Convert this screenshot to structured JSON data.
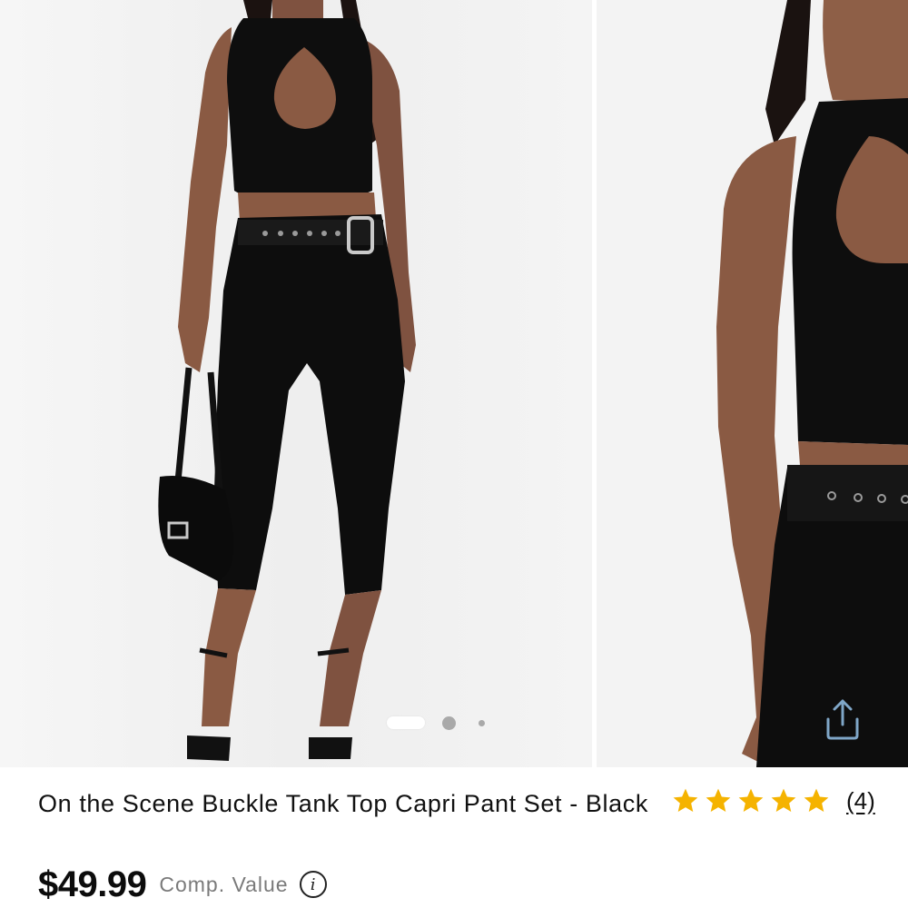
{
  "gallery": {
    "images": [
      {
        "alt": "On the Scene Buckle Tank Top Capri Pant Set - Black, full length front view"
      },
      {
        "alt": "On the Scene Buckle Tank Top Capri Pant Set - Black, close-up"
      }
    ],
    "active_index": 0,
    "total": 3
  },
  "share": {
    "icon": "share-icon"
  },
  "product": {
    "title": "On the Scene Buckle Tank Top Capri Pant Set - Black",
    "rating": {
      "value": 5,
      "max": 5,
      "count_label": "(4)",
      "star_color": "#F5B300"
    },
    "price": "$49.99",
    "comp_value_label": "Comp. Value",
    "info_icon_glyph": "i"
  }
}
